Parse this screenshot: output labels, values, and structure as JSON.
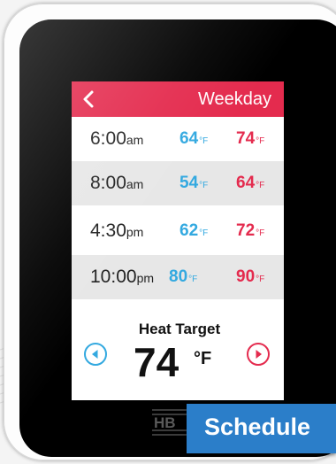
{
  "header": {
    "title": "Weekday",
    "back_icon": "chevron-left-icon"
  },
  "schedule": [
    {
      "time": "6:00",
      "ampm": "am",
      "low": "64",
      "high": "74",
      "unit": "°F"
    },
    {
      "time": "8:00",
      "ampm": "am",
      "low": "54",
      "high": "64",
      "unit": "°F"
    },
    {
      "time": "4:30",
      "ampm": "pm",
      "low": "62",
      "high": "72",
      "unit": "°F"
    },
    {
      "time": "10:00",
      "ampm": "pm",
      "low": "80",
      "high": "90",
      "unit": "°F"
    }
  ],
  "target": {
    "label": "Heat Target",
    "value": "74",
    "unit": "°F",
    "prev_icon": "arrow-left-icon",
    "next_icon": "arrow-right-icon"
  },
  "logo_text": "HB",
  "schedule_button": {
    "label": "Schedule"
  },
  "colors": {
    "accent_red": "#e42b4e",
    "accent_blue": "#33a9e0",
    "button_blue": "#2b7ec9",
    "bezel": "#000000"
  }
}
